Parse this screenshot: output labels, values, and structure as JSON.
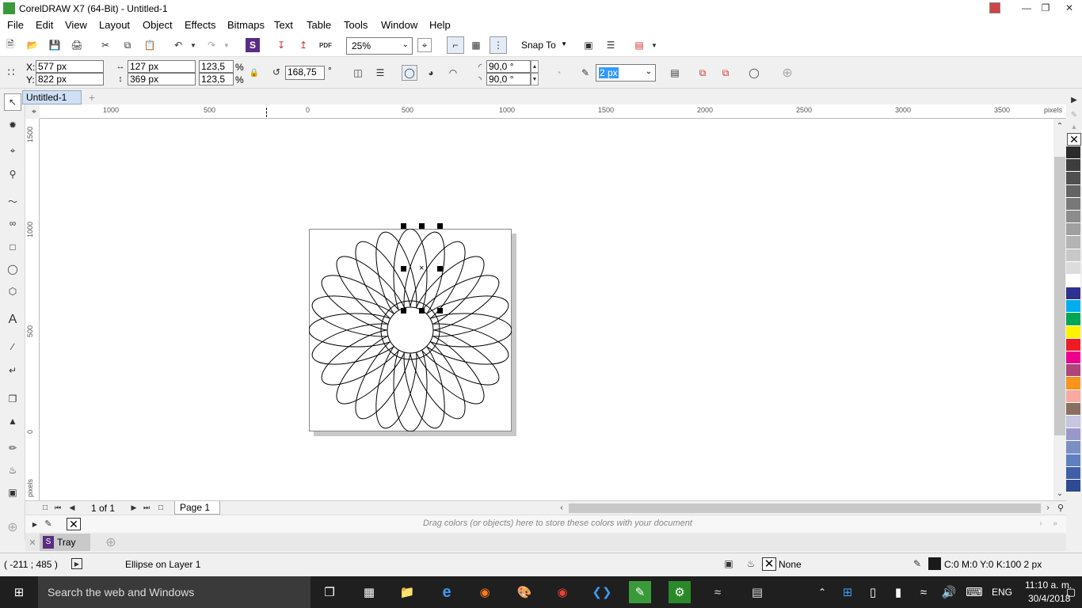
{
  "window": {
    "title": "CorelDRAW X7 (64-Bit) - Untitled-1"
  },
  "menu": [
    "File",
    "Edit",
    "View",
    "Layout",
    "Object",
    "Effects",
    "Bitmaps",
    "Text",
    "Table",
    "Tools",
    "Window",
    "Help"
  ],
  "standard_toolbar": {
    "zoom": "25%",
    "snap_to": "Snap To"
  },
  "property_bar": {
    "x_label": "X:",
    "y_label": "Y:",
    "x": "577 px",
    "y": "822 px",
    "width": "127 px",
    "height": "369 px",
    "scale_w": "123,5",
    "scale_h": "123,5",
    "percent": "%",
    "angle": "168,75",
    "degree": "°",
    "start_angle": "90,0 °",
    "end_angle": "90,0 °",
    "outline_width": "2 px"
  },
  "document_tab": "Untitled-1",
  "ruler": {
    "h_labels": [
      "1000",
      "500",
      "0",
      "500",
      "1000",
      "1500",
      "2000",
      "2500",
      "3000",
      "3500"
    ],
    "units": "pixels",
    "v_labels": [
      "1500",
      "1000",
      "500",
      "0"
    ]
  },
  "pager": {
    "page_count": "1 of 1",
    "page_tab": "Page 1"
  },
  "doc_palette": {
    "hint": "Drag colors (or objects) here to store these colors with your document"
  },
  "tray": {
    "label": "Tray"
  },
  "status": {
    "cursor": "( -211 ; 485  )",
    "selection": "Ellipse on Layer 1",
    "fill": "None",
    "outline": "C:0 M:0 Y:0 K:100  2 px"
  },
  "palette_colors": [
    "#2b2b2b",
    "#3d3d3d",
    "#4f4f4f",
    "#636363",
    "#787878",
    "#8c8c8c",
    "#a0a0a0",
    "#b4b4b4",
    "#c8c8c8",
    "#dcdcdc",
    "#ffffff",
    "#2e3192",
    "#00aeef",
    "#00a651",
    "#fff200",
    "#ed1c24",
    "#ec008c",
    "#b0447c",
    "#f7941d",
    "#f9a99f",
    "#8b6f5e",
    "#c7c5e0",
    "#9a98cb",
    "#7b8fc4",
    "#5f7fbf",
    "#3f5fa8",
    "#2e4a90"
  ],
  "taskbar": {
    "search": "Search the web and Windows",
    "lang": "ENG",
    "time": "11:10 a. m.",
    "date": "30/4/2018"
  }
}
